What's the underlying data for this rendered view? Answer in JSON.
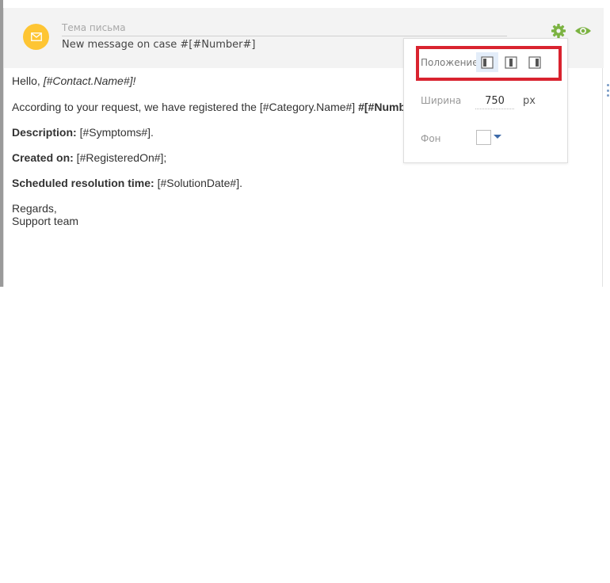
{
  "header": {
    "subject_label": "Тема письма",
    "subject_value": "New message on case #[#Number#]"
  },
  "icons": {
    "envelope": "envelope-icon",
    "settings": "gear-icon",
    "preview": "eye-icon"
  },
  "colors": {
    "envelope_bg": "#fec533",
    "accent_green": "#7cb342",
    "highlight_red": "#d9232f",
    "active_align_bg": "#e3edf9"
  },
  "body": {
    "hello_prefix": "Hello, ",
    "hello_macro": "[#Contact.Name#]!",
    "intro_text": "According to your request, we have registered the [#Category.Name#] ",
    "intro_bold": "#[#Numb",
    "desc_label": "Description:",
    "desc_value": " [#Symptoms#].",
    "created_label": "Created on:",
    "created_value": " [#RegisteredOn#];",
    "sched_label": "Scheduled resolution time:",
    "sched_value": " [#SolutionDate#].",
    "regards": "Regards,",
    "team": "Support team"
  },
  "settings_popup": {
    "position_label": "Положение",
    "align_options": [
      "align-left",
      "align-center",
      "align-right"
    ],
    "active_align": "align-left",
    "width_label": "Ширина",
    "width_value": "750",
    "width_unit": "px",
    "background_label": "Фон",
    "background_color": "#ffffff"
  }
}
